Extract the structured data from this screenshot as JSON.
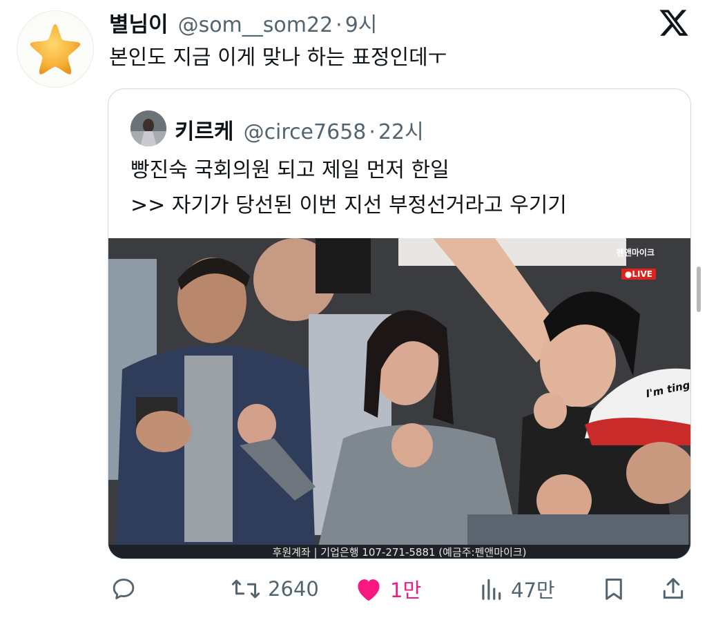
{
  "tweet": {
    "display_name": "별님이",
    "handle": "@som__som22",
    "separator": "·",
    "time": "9시",
    "text": "본인도 지금 이게 맞나 하는 표정인데ㅜ",
    "avatar_icon": "star-icon"
  },
  "quoted": {
    "display_name": "키르케",
    "handle": "@circe7658",
    "separator": "·",
    "time": "22시",
    "lines": [
      "빵진숙 국회의원 되고 제일 먼저 한일",
      ">> 자기가 당선된 이번 지선 부정선거라고 우기기"
    ],
    "media": {
      "brand": "펜앤마이크",
      "live": "●LIVE",
      "caption": "후원계좌 | 기업은행 107-271-5881 (예금주:펜앤마이크)",
      "cap_text": "I'm ting"
    }
  },
  "actions": {
    "reply_icon": "reply-icon",
    "retweet_count": "2640",
    "like_count": "1만",
    "views_count": "47만",
    "bookmark_icon": "bookmark-icon",
    "share_icon": "share-icon"
  },
  "colors": {
    "like": "#f91880",
    "muted": "#536471",
    "text": "#0f1419",
    "border": "#cfd9de"
  }
}
